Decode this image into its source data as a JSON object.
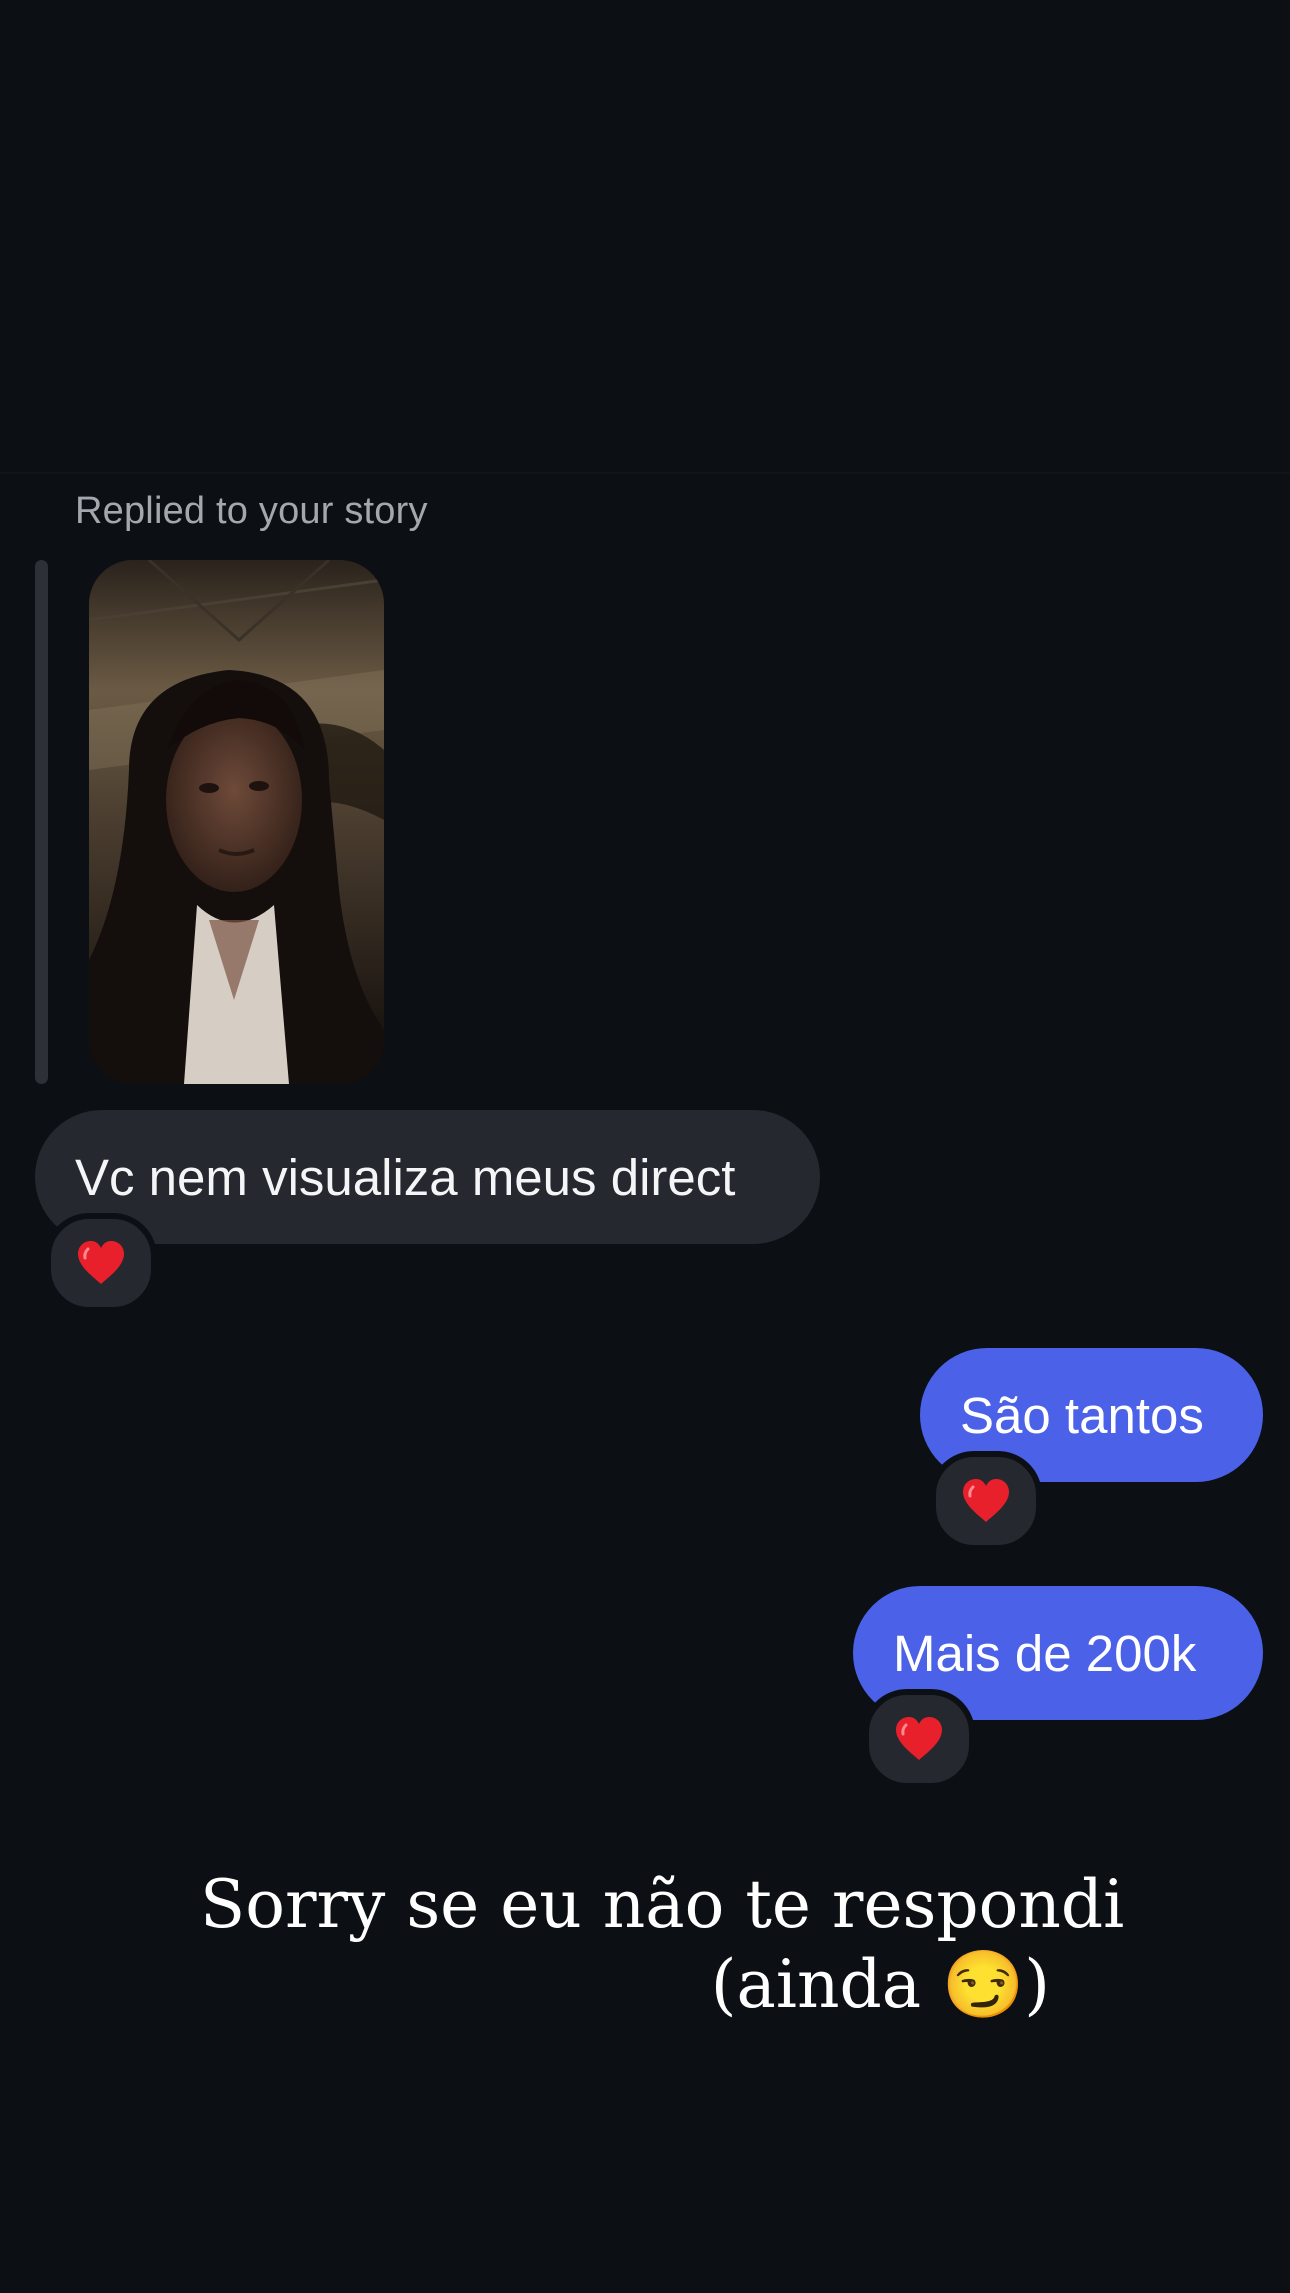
{
  "reply": {
    "label": "Replied to your story"
  },
  "messages": [
    {
      "direction": "incoming",
      "text": "Vc nem visualiza meus direct",
      "reaction": "heart-emoji"
    },
    {
      "direction": "outgoing",
      "text": "São tantos",
      "reaction": "heart-emoji"
    },
    {
      "direction": "outgoing",
      "text": "Mais de 200k",
      "reaction": "heart-emoji"
    }
  ],
  "story_caption": {
    "line1": "Sorry se eu não te respondi",
    "line2": "(ainda 😏)"
  },
  "colors": {
    "background": "#0c0f14",
    "incoming_bubble": "#25282e",
    "outgoing_bubble": "#4a61e8",
    "reaction_heart": "#e8202c"
  }
}
